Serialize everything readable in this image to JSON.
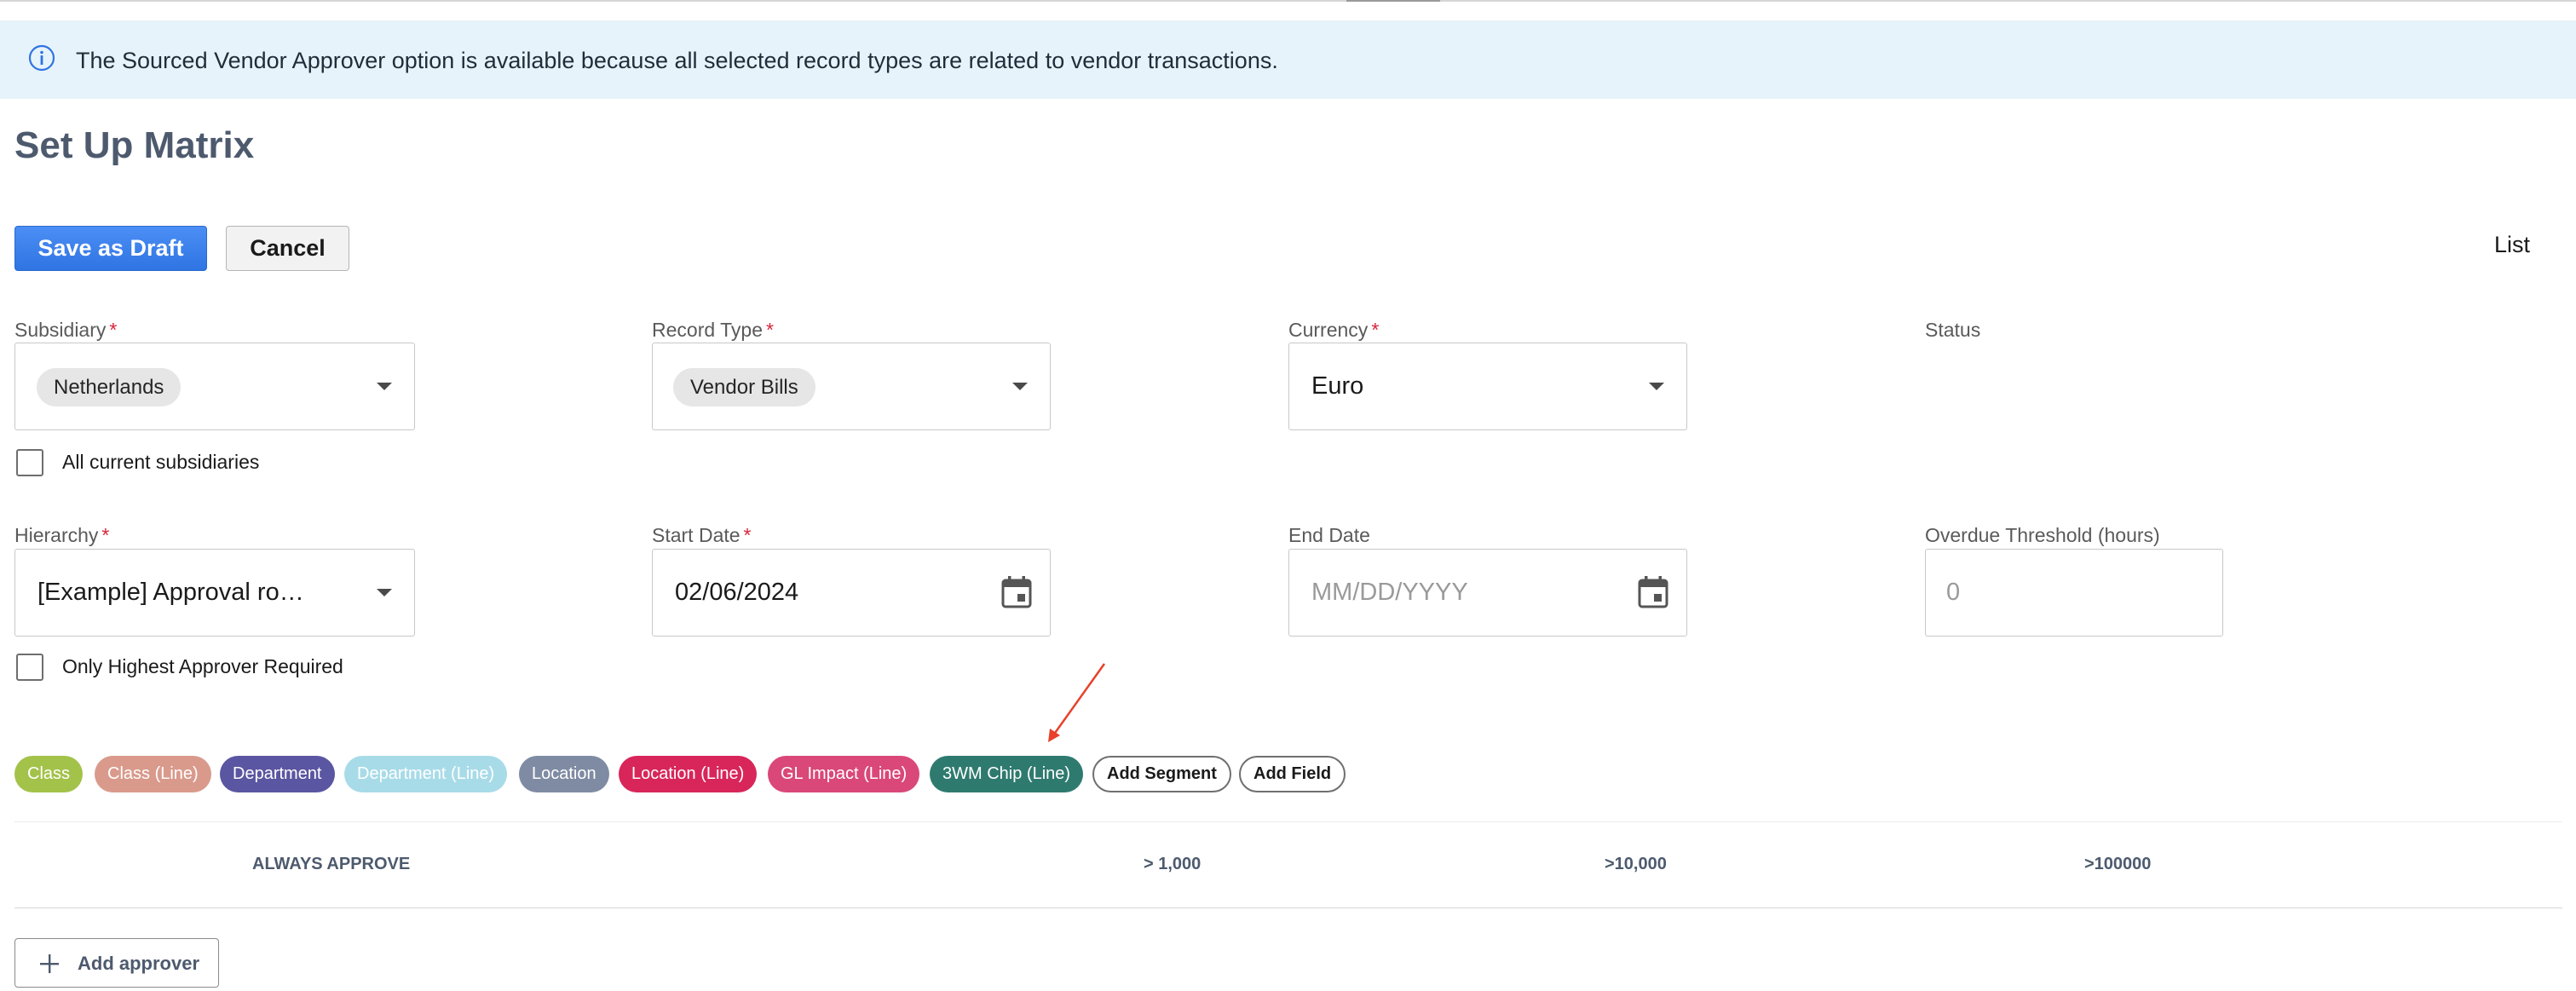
{
  "banner": {
    "text": "The Sourced Vendor Approver option is available because all selected record types are related to vendor transactions.",
    "icon": "info-icon",
    "background": "#e7f3fa"
  },
  "page": {
    "title": "Set Up Matrix"
  },
  "toolbar": {
    "save_label": "Save as Draft",
    "cancel_label": "Cancel",
    "list_label": "List"
  },
  "fields": {
    "subsidiary": {
      "label": "Subsidiary",
      "required": "*",
      "value": "Netherlands"
    },
    "record_type": {
      "label": "Record Type",
      "required": "*",
      "value": "Vendor Bills"
    },
    "currency": {
      "label": "Currency",
      "required": "*",
      "value": "Euro"
    },
    "status": {
      "label": "Status"
    },
    "all_subsidiaries": {
      "label": "All current subsidiaries",
      "checked": false
    },
    "hierarchy": {
      "label": "Hierarchy",
      "required": "*",
      "value": "[Example] Approval ro…"
    },
    "start_date": {
      "label": "Start Date",
      "required": "*",
      "value": "02/06/2024"
    },
    "end_date": {
      "label": "End Date",
      "placeholder": "MM/DD/YYYY"
    },
    "overdue_threshold": {
      "label": "Overdue Threshold (hours)",
      "placeholder": "0"
    },
    "highest_approver": {
      "label": "Only Highest Approver Required",
      "checked": false
    }
  },
  "segments": [
    {
      "label": "Class",
      "color": "#a3c24a"
    },
    {
      "label": "Class (Line)",
      "color": "#d99a8c"
    },
    {
      "label": "Department",
      "color": "#5a56a1"
    },
    {
      "label": "Department (Line)",
      "color": "#a8dbe8"
    },
    {
      "label": "Location",
      "color": "#7f8ba3"
    },
    {
      "label": "Location (Line)",
      "color": "#d8265a"
    },
    {
      "label": "GL Impact (Line)",
      "color": "#d94878"
    },
    {
      "label": "3WM Chip (Line)",
      "color": "#2f7a6f"
    }
  ],
  "segment_actions": {
    "add_segment": "Add Segment",
    "add_field": "Add Field"
  },
  "table": {
    "columns": [
      "ALWAYS APPROVE",
      "> 1,000",
      ">10,000",
      ">100000"
    ]
  },
  "footer": {
    "add_approver_label": "Add approver"
  },
  "colors": {
    "accent": "#2f74e2",
    "required": "#d9243a",
    "annotation": "#e8402a"
  }
}
